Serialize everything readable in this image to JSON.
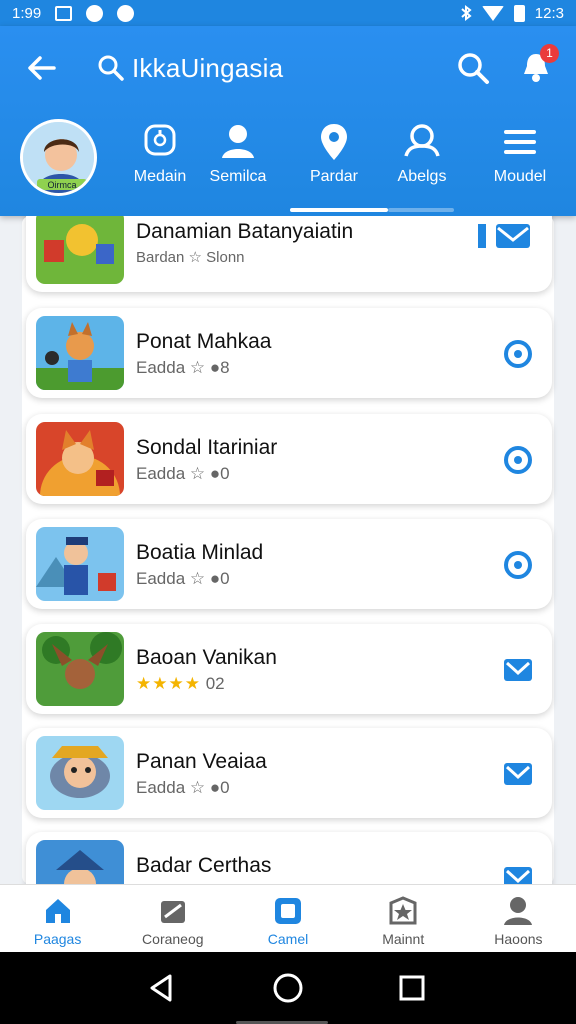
{
  "status_bar": {
    "time": "1:99",
    "clock_right": "12:3",
    "icons": [
      "image-icon",
      "chat-icon",
      "bluetooth-icon",
      "wifi-icon",
      "battery-icon"
    ]
  },
  "app_bar": {
    "search_text": "IkkaUingasia",
    "notification_count": "1"
  },
  "tabs": [
    {
      "label": "Medain",
      "icon": "badge-icon"
    },
    {
      "label": "Semilca",
      "icon": "person-icon"
    },
    {
      "label": "Pardar",
      "icon": "location-pin-icon"
    },
    {
      "label": "Abelgs",
      "icon": "group-icon"
    },
    {
      "label": "Moudel",
      "icon": "menu-icon"
    }
  ],
  "avatar": {
    "caption": "Oirmca"
  },
  "games": [
    {
      "name": "Danamian Batanyaiatin",
      "sub": "Bardan ☆ Slonn",
      "action": "mail-icon",
      "kind": "folder"
    },
    {
      "name": "Ponat Mahkaa",
      "sub": "Eadda ☆ ●8",
      "action": "radio-icon"
    },
    {
      "name": "Sondal Itariniar",
      "sub": "Eadda ☆ ●0",
      "action": "radio-icon"
    },
    {
      "name": "Boatia Minlad",
      "sub": "Eadda ☆ ●0",
      "action": "radio-icon"
    },
    {
      "name": "Baoan Vanikan",
      "stars": "★★★★",
      "sub": "02",
      "action": "mail-icon"
    },
    {
      "name": "Panan Veaiaa",
      "sub": "Eadda ☆ ●0",
      "action": "mail-icon"
    },
    {
      "name": "Badar Certhas",
      "sub": "",
      "action": "mail-icon"
    }
  ],
  "bottom_nav": [
    {
      "label": "Paagas",
      "icon": "home-icon",
      "active": true
    },
    {
      "label": "Coraneog",
      "icon": "tag-icon",
      "active": false
    },
    {
      "label": "Camel",
      "icon": "square-icon",
      "active": true
    },
    {
      "label": "Mainnt",
      "icon": "map-star-icon",
      "active": false
    },
    {
      "label": "Haoons",
      "icon": "person-icon",
      "active": false
    }
  ],
  "colors": {
    "primary": "#1f86e0",
    "badge": "#ea3b3b",
    "star": "#f4b400"
  }
}
